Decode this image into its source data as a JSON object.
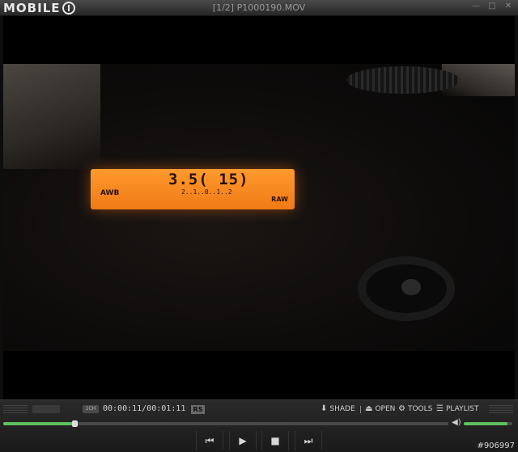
{
  "titlebar": {
    "logo_text": "MOBILE",
    "title": "[1/2] P1000190.MOV",
    "controls": {
      "minimize": "—",
      "maximize": "□",
      "close": "✕"
    }
  },
  "video": {
    "lcd": {
      "main": "3.5(  15)",
      "awb": "AWB",
      "raw": "RAW",
      "scale": "2..1..0..1..2"
    }
  },
  "info_bar": {
    "badge": "1CH",
    "time": "00:00:11/00:01:11",
    "rs_label": "RS",
    "shade": "SHADE",
    "open": "OPEN",
    "tools": "TOOLS",
    "playlist": "PLAYLIST"
  },
  "seek": {
    "position_fraction": 0.16
  },
  "volume": {
    "level_fraction": 0.9
  },
  "icons": {
    "shade": "download-arrow-icon",
    "open": "eject-icon",
    "tools": "gear-icon",
    "playlist": "list-icon",
    "volume": "speaker-icon",
    "prev": "previous-track-icon",
    "play": "play-icon",
    "stop": "stop-icon",
    "next": "next-track-icon"
  },
  "transport": {
    "prev": "⏮",
    "play": "▶",
    "stop": "■",
    "next": "⏭"
  },
  "watermark": "#906997",
  "colors": {
    "accent_green": "#5fbf5f",
    "lcd_orange": "#f07a16"
  }
}
